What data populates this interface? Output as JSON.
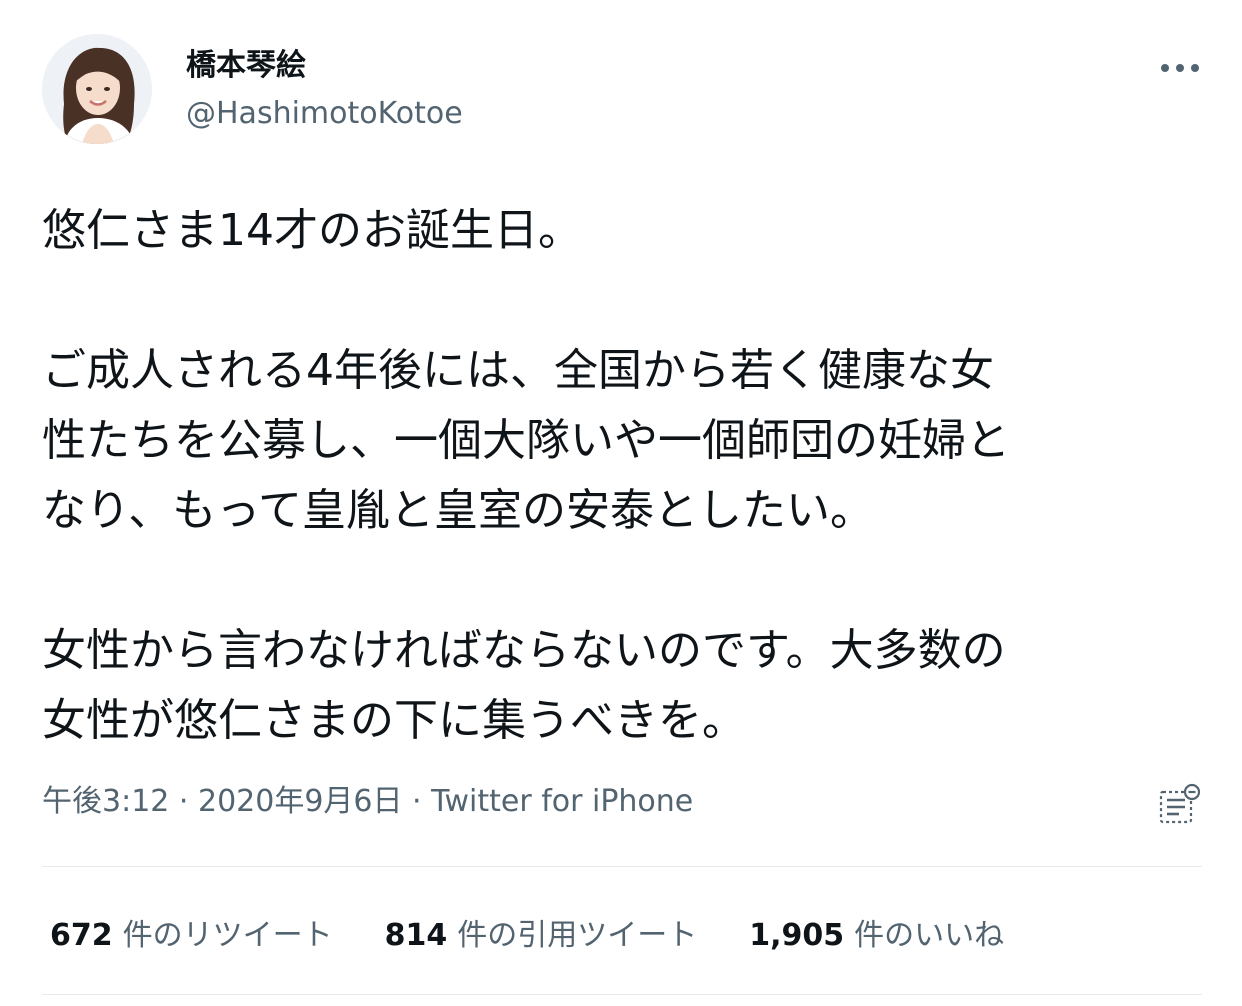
{
  "author": {
    "display_name": "橋本琴絵",
    "handle": "@HashimotoKotoe"
  },
  "tweet": {
    "line1": "悠仁さま14才のお誕生日。",
    "para2_line1": "ご成人される4年後には、全国から若く健康な女",
    "para2_line2": "性たちを公募し、一個大隊いや一個師団の妊婦と",
    "para2_line3": "なり、もって皇胤と皇室の安泰としたい。",
    "para3_line1": "女性から言わなければならないのです。大多数の",
    "para3_line2": "女性が悠仁さまの下に集うべきを。"
  },
  "meta": {
    "time": "午後3:12",
    "separator": " · ",
    "date": "2020年9月6日",
    "source": "Twitter for iPhone"
  },
  "stats": {
    "retweets_count": "672",
    "retweets_label": "件のリツイート",
    "quotes_count": "814",
    "quotes_label": "件の引用ツイート",
    "likes_count": "1,905",
    "likes_label": "件のいいね"
  },
  "icons": {
    "more": "more-dots-icon",
    "analytics": "tweet-analytics-icon",
    "avatar": "profile-avatar"
  },
  "colors": {
    "text": "#0f1419",
    "secondary": "#536471",
    "divider": "#e6ecf0"
  }
}
